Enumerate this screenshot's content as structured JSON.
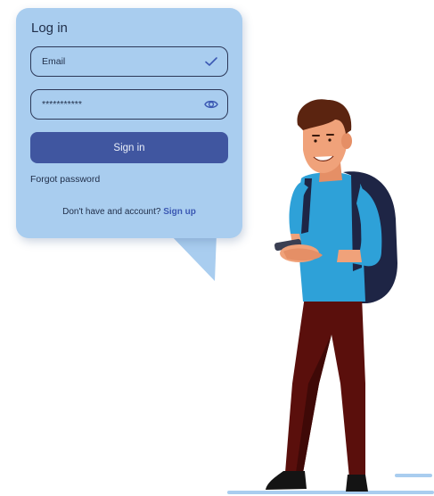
{
  "login": {
    "title": "Log in",
    "email_value": "Email",
    "password_value": "***********",
    "signin_label": "Sign in",
    "forgot_label": "Forgot password",
    "no_account_text": "Don't have and account? ",
    "signup_label": "Sign up"
  },
  "icons": {
    "email_status": "check-icon",
    "password_toggle": "eye-icon"
  },
  "colors": {
    "card": "#a9cdef",
    "button": "#4056a0",
    "link": "#3b58b3"
  }
}
